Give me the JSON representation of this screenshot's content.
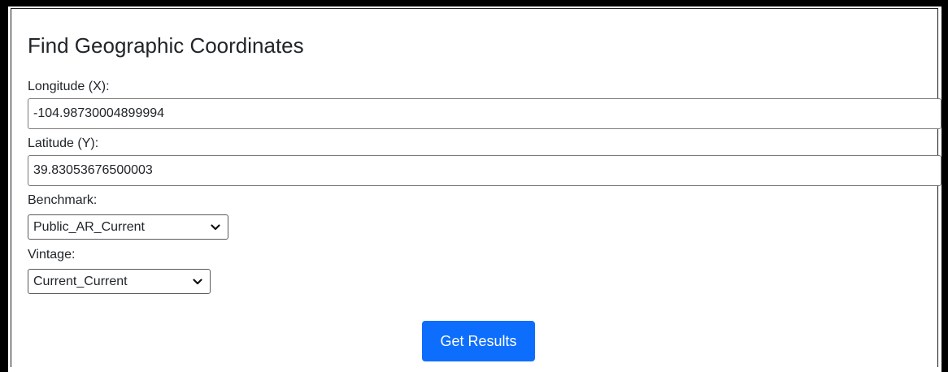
{
  "form": {
    "title": "Find Geographic Coordinates",
    "longitude": {
      "label": "Longitude (X):",
      "value": "-104.98730004899994"
    },
    "latitude": {
      "label": "Latitude (Y):",
      "value": "39.83053676500003"
    },
    "benchmark": {
      "label": "Benchmark:",
      "selected": "Public_AR_Current"
    },
    "vintage": {
      "label": "Vintage:",
      "selected": "Current_Current"
    },
    "submit_label": "Get Results"
  },
  "icons": {
    "select_chevron": "chevron-down-icon"
  },
  "colors": {
    "accent": "#0d6efd",
    "text": "#212529",
    "frame": "#000000"
  }
}
